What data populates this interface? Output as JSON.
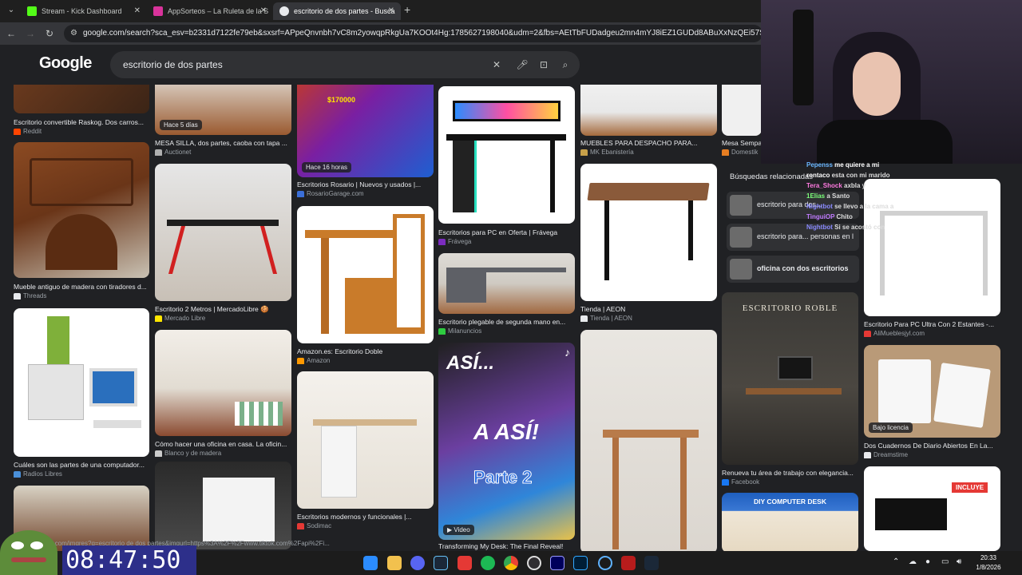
{
  "browser": {
    "tabs": [
      {
        "title": "Stream - Kick Dashboard",
        "active": false,
        "favicon_color": "#53fc18"
      },
      {
        "title": "AppSorteos – La Ruleta de la S",
        "active": false,
        "favicon_color": "#d9339b"
      },
      {
        "title": "escritorio de dos partes - Busca",
        "active": true,
        "favicon_color": "#9aa0a6"
      }
    ],
    "url": "google.com/search?sca_esv=b2331d7122fe79eb&sxsrf=APpeQnvnbh7vC8m2yowqpRkgUa7KOOt4Hg:1785627198040&udm=2&fbs=AEtTbFUDadgeu2mn4mYJ8iEZ1GUDd8ABuXxNzQEi57SWOuuPdScLx3oIs"
  },
  "google": {
    "logo": "Google",
    "query": "escritorio de dos partes"
  },
  "results": {
    "col1": [
      {
        "caption": "Escritorio convertible Raskog. Dos carros...",
        "source": "Reddit",
        "fav": "#ff4500"
      },
      {
        "caption": "Mueble antiguo de madera con tiradores d...",
        "source": "Threads",
        "fav": "#e8eaed"
      },
      {
        "caption": "Cuáles son las partes de una computador...",
        "source": "Radios Libres",
        "fav": "#4a90d9"
      }
    ],
    "col2": [
      {
        "caption": "MESA SILLA, dos partes, caoba con tapa ...",
        "source": "Auctionet",
        "fav": "#b0b0b0",
        "badge": "Hace 5 días"
      },
      {
        "caption": "Escritorio 2 Metros | MercadoLibre 🍪",
        "source": "Mercado Libre",
        "fav": "#ffe600"
      },
      {
        "caption": "Cómo hacer una oficina en casa. La oficin...",
        "source": "Blanco y de madera",
        "fav": "#cccccc"
      }
    ],
    "col3": [
      {
        "caption": "Escritorios Rosario | Nuevos y usados |...",
        "source": "RosarioGarage.com",
        "fav": "#3b6fd8",
        "badge": "Hace 16 horas"
      },
      {
        "caption": "Amazon.es: Escritorio Doble",
        "source": "Amazon",
        "fav": "#ff9900"
      },
      {
        "caption": "Escritorios modernos y funcionales |...",
        "source": "Sodimac",
        "fav": "#e53935"
      }
    ],
    "col4": [
      {
        "caption": "Escritorios para PC en Oferta | Frávega",
        "source": "Frávega",
        "fav": "#7b2cbf"
      },
      {
        "caption": "Escritorio plegable de segunda mano en...",
        "source": "Milanuncios",
        "fav": "#2ecc40"
      },
      {
        "caption": "Transforming My Desk: The Final Reveal!",
        "source": "",
        "fav": "#000000",
        "badge": "▶ Video"
      }
    ],
    "col5": [
      {
        "caption": "MUEBLES PARA DESPACHO PARA...",
        "source": "MK Ebanistería",
        "fav": "#c8a14a"
      },
      {
        "caption": "Tienda | AEON",
        "source": "Tienda | AEON",
        "fav": "#e8eaed"
      }
    ],
    "col6": [
      {
        "caption": "Mesa Sempa...",
        "source": "Domestik",
        "fav": "#e67e22"
      },
      {
        "caption": "Renueva tu área de trabajo con elegancia...",
        "source": "Facebook",
        "fav": "#1877f2"
      }
    ],
    "col7": [
      {
        "caption": "Escritorio Para PC Ultra Con 2 Estantes -...",
        "source": "AliMueblesjyl.com",
        "fav": "#e53935"
      },
      {
        "caption": "Dos Cuadernos De Diario Abiertos En La...",
        "source": "Dreamstime",
        "fav": "#e8eaed",
        "badge": "Bajo licencia"
      }
    ],
    "overlay_texts": {
      "roble_title": "ESCRITORIO ROBLE",
      "diy": "DIY COMPUTER DESK",
      "incluye": "INCLUYE",
      "asi1": "ASÍ...",
      "asi2": "A ASÍ!",
      "parte": "Parte 2",
      "price": "$170000"
    }
  },
  "related": {
    "title": "Búsquedas relacionadas",
    "items": [
      {
        "label": "escritorio para dos..."
      },
      {
        "label": "escritorio para... personas en l"
      },
      {
        "label": "oficina con dos escritorios"
      }
    ]
  },
  "chat": [
    {
      "user": "Pepenss",
      "text": "me quiere a mi",
      "color": "#6ab7ff"
    },
    {
      "user": "rontaco",
      "text": "esta con mi marido",
      "color": "#ffffff"
    },
    {
      "user": "Tera_Shock",
      "text": "axbla y",
      "color": "#ff7ae0"
    },
    {
      "user": "1Elias",
      "text": "a Santo",
      "color": "#7cff7a"
    },
    {
      "user": "Nightbot",
      "text": "se llevo a la cama a",
      "color": "#8a8aff"
    },
    {
      "user": "TinguiOP",
      "text": "Chito",
      "color": "#c07aff"
    },
    {
      "user": "Nightbot",
      "text": "Si se acostó con",
      "color": "#8a8aff"
    }
  ],
  "stream": {
    "timer": "08:47:50"
  },
  "status_url": "...com/imgres?q=escritorio de dos partes&imgurl=https%3A%2F%2Fwww.tiktok.com%2Fapi%2Fi...",
  "taskbar": {
    "time": "20:33",
    "date": "1/8/2026",
    "icons": [
      "windows-icon",
      "explorer-icon",
      "discord-icon",
      "steam-icon",
      "app-icon",
      "spotify-icon",
      "chrome-icon",
      "obs-icon",
      "premiere-icon",
      "photoshop-icon",
      "refresh-icon",
      "stream-icon",
      "steam2-icon"
    ]
  }
}
